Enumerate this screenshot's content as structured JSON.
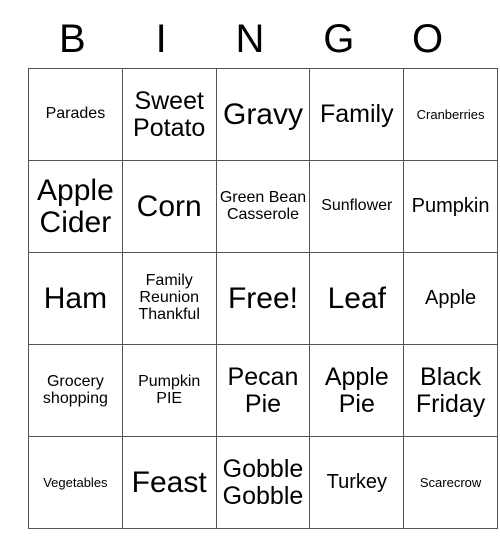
{
  "card": {
    "title_letters": [
      "B",
      "I",
      "N",
      "G",
      "O"
    ],
    "columns": 5,
    "rows": 5,
    "free_space_label": "Free!",
    "grid": [
      [
        {
          "label": "Parades",
          "size": "sm"
        },
        {
          "label": "Sweet Potato",
          "size": "lg"
        },
        {
          "label": "Gravy",
          "size": "xl"
        },
        {
          "label": "Family",
          "size": "lg"
        },
        {
          "label": "Cranberries",
          "size": "xs"
        }
      ],
      [
        {
          "label": "Apple Cider",
          "size": "xl"
        },
        {
          "label": "Corn",
          "size": "xl"
        },
        {
          "label": "Green Bean Casserole",
          "size": "sm"
        },
        {
          "label": "Sunflower",
          "size": "sm"
        },
        {
          "label": "Pumpkin",
          "size": "md"
        }
      ],
      [
        {
          "label": "Ham",
          "size": "xl"
        },
        {
          "label": "Family Reunion Thankful",
          "size": "sm"
        },
        {
          "label": "Free!",
          "size": "xl"
        },
        {
          "label": "Leaf",
          "size": "xl"
        },
        {
          "label": "Apple",
          "size": "md"
        }
      ],
      [
        {
          "label": "Grocery shopping",
          "size": "sm"
        },
        {
          "label": "Pumpkin PIE",
          "size": "sm"
        },
        {
          "label": "Pecan Pie",
          "size": "lg"
        },
        {
          "label": "Apple Pie",
          "size": "lg"
        },
        {
          "label": "Black Friday",
          "size": "lg"
        }
      ],
      [
        {
          "label": "Vegetables",
          "size": "xs"
        },
        {
          "label": "Feast",
          "size": "xl"
        },
        {
          "label": "Gobble Gobble",
          "size": "lg"
        },
        {
          "label": "Turkey",
          "size": "md"
        },
        {
          "label": "Scarecrow",
          "size": "xs"
        }
      ]
    ]
  },
  "colors": {
    "background": "#ffffff",
    "text": "#000000",
    "grid_line": "#555555"
  }
}
